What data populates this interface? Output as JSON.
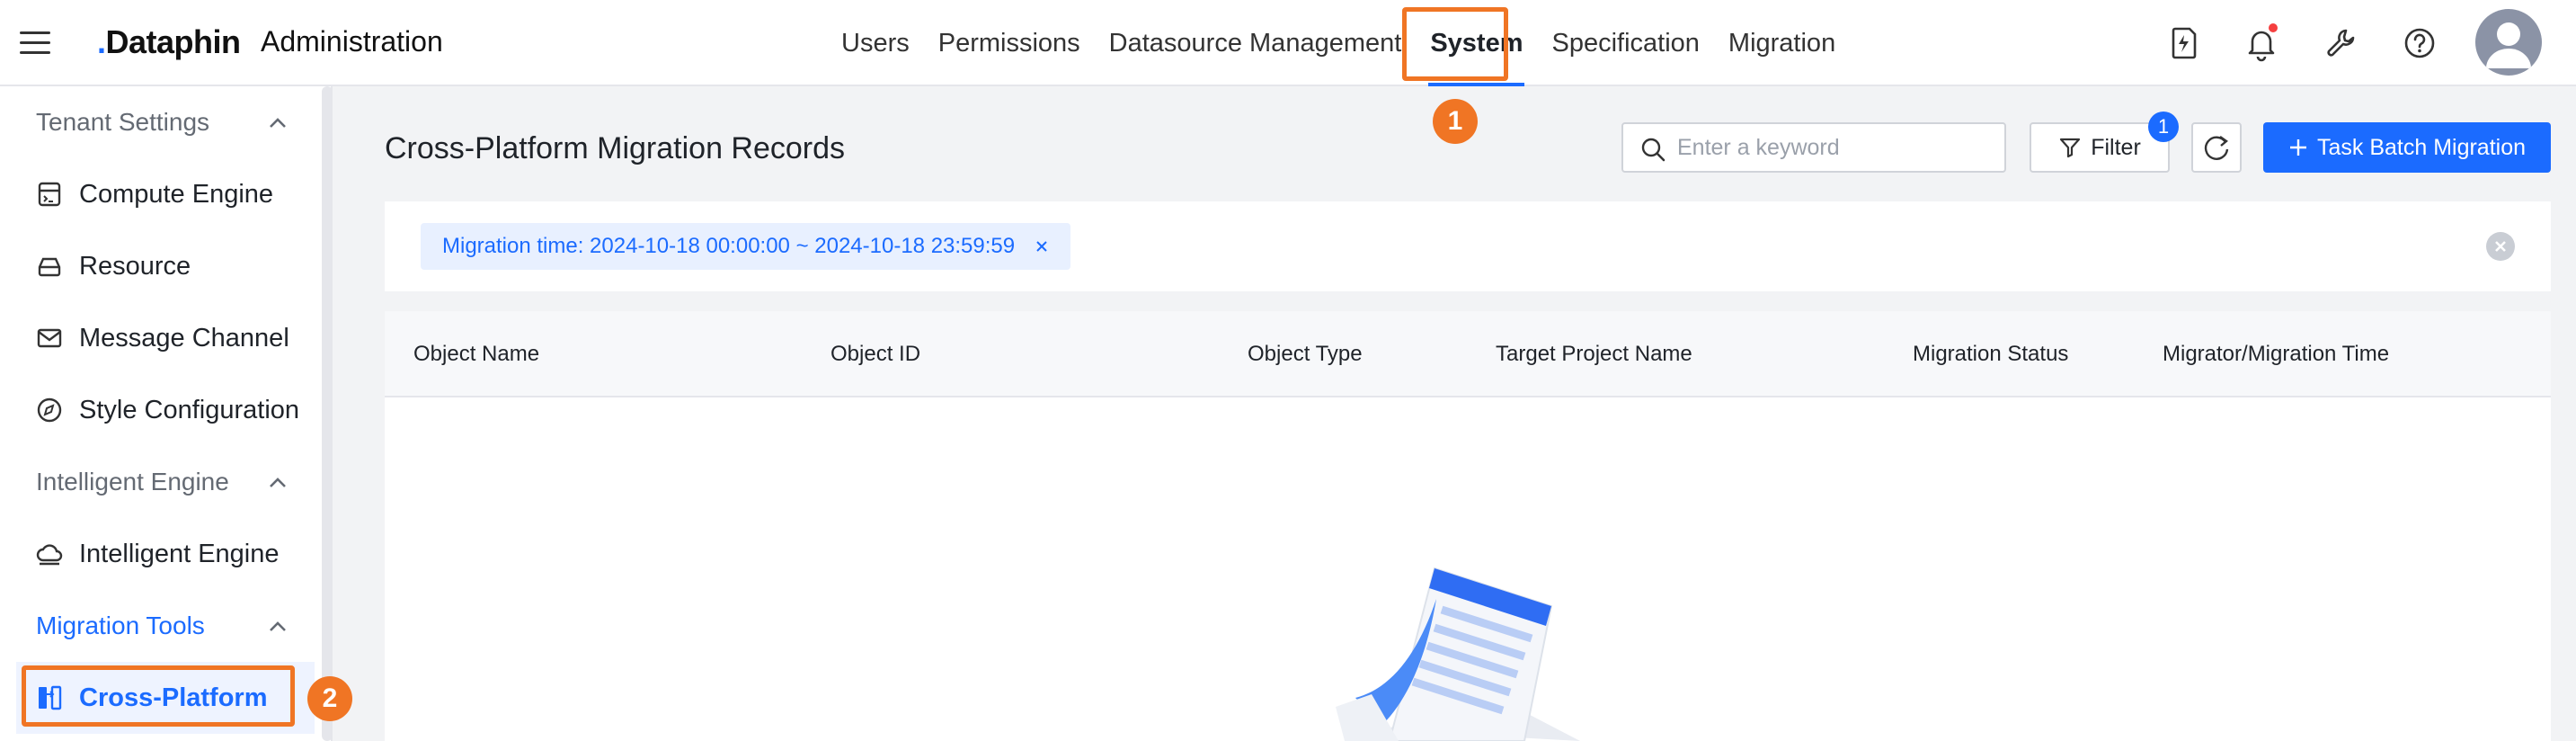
{
  "header": {
    "logo": "Dataphin",
    "title": "Administration",
    "nav": [
      "Users",
      "Permissions",
      "Datasource Management",
      "System",
      "Specification",
      "Migration"
    ],
    "active_nav": "System"
  },
  "markers": {
    "one": "1",
    "two": "2"
  },
  "sidebar": {
    "groups": [
      {
        "label": "Tenant Settings",
        "items": [
          "Compute Engine",
          "Resource",
          "Message Channel",
          "Style Configuration"
        ]
      },
      {
        "label": "Intelligent Engine",
        "items": [
          "Intelligent Engine"
        ]
      },
      {
        "label": "Migration Tools",
        "items": [
          "Cross-Platform"
        ]
      }
    ],
    "active_item": "Cross-Platform"
  },
  "main": {
    "title": "Cross-Platform Migration Records",
    "search_placeholder": "Enter a keyword",
    "filter_label": "Filter",
    "filter_count": "1",
    "primary_button": "Task Batch Migration",
    "chip": "Migration time: 2024-10-18 00:00:00 ~ 2024-10-18 23:59:59",
    "columns": [
      "Object Name",
      "Object ID",
      "Object Type",
      "Target Project Name",
      "Migration Status",
      "Migrator/Migration Time"
    ]
  },
  "colors": {
    "accent": "#1b6bff",
    "highlight": "#f07524",
    "notification": "#f53f3f"
  }
}
